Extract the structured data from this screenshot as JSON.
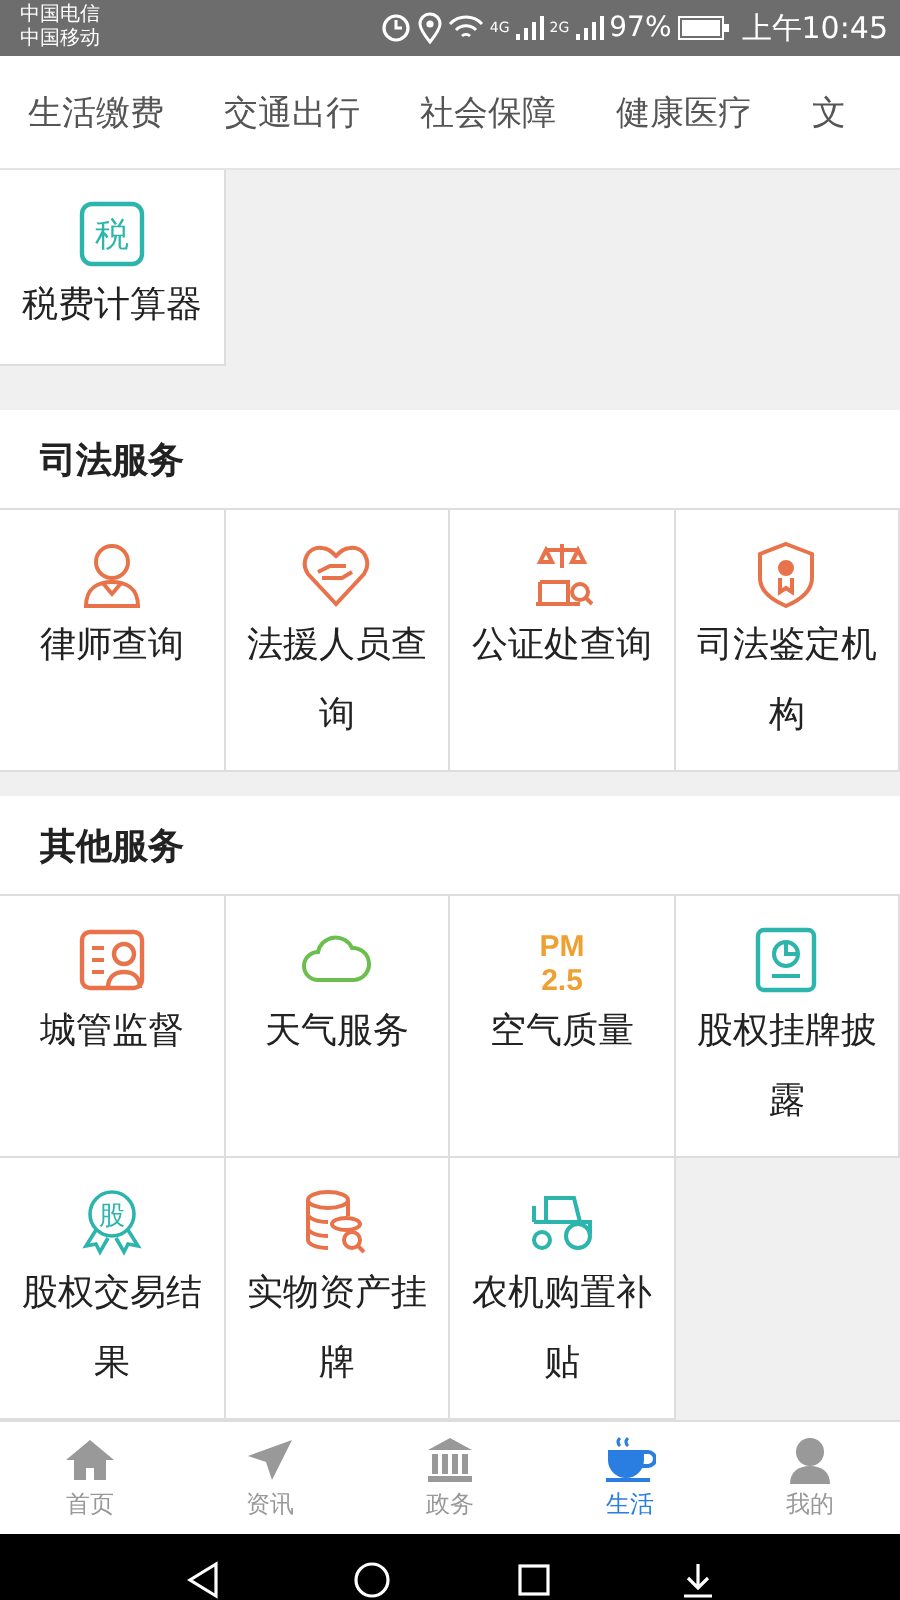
{
  "status_bar": {
    "carriers": [
      "中国电信",
      "中国移动"
    ],
    "network": [
      "4G",
      "2G"
    ],
    "battery": "97%",
    "time": "上午10:45"
  },
  "tabs": [
    {
      "label": "生活缴费"
    },
    {
      "label": "交通出行"
    },
    {
      "label": "社会保障"
    },
    {
      "label": "健康医疗"
    },
    {
      "label": "文"
    }
  ],
  "top_items": [
    {
      "label": "税费计算器",
      "icon_text": [
        "税"
      ]
    }
  ],
  "sections": [
    {
      "title": "司法服务",
      "items": [
        {
          "label": "律师查询"
        },
        {
          "label": "法援人员查询"
        },
        {
          "label": "公证处查询"
        },
        {
          "label": "司法鉴定机构"
        }
      ]
    },
    {
      "title": "其他服务",
      "items": [
        {
          "label": "城管监督"
        },
        {
          "label": "天气服务"
        },
        {
          "label": "空气质量",
          "icon_text": [
            "PM",
            "2.5"
          ]
        },
        {
          "label": "股权挂牌披露"
        },
        {
          "label": "股权交易结果",
          "icon_text": [
            "股"
          ]
        },
        {
          "label": "实物资产挂牌"
        },
        {
          "label": "农机购置补贴"
        }
      ]
    }
  ],
  "bottom_nav": [
    {
      "label": "首页",
      "selected": false
    },
    {
      "label": "资讯",
      "selected": false
    },
    {
      "label": "政务",
      "selected": false
    },
    {
      "label": "生活",
      "selected": true
    },
    {
      "label": "我的",
      "selected": false
    }
  ]
}
